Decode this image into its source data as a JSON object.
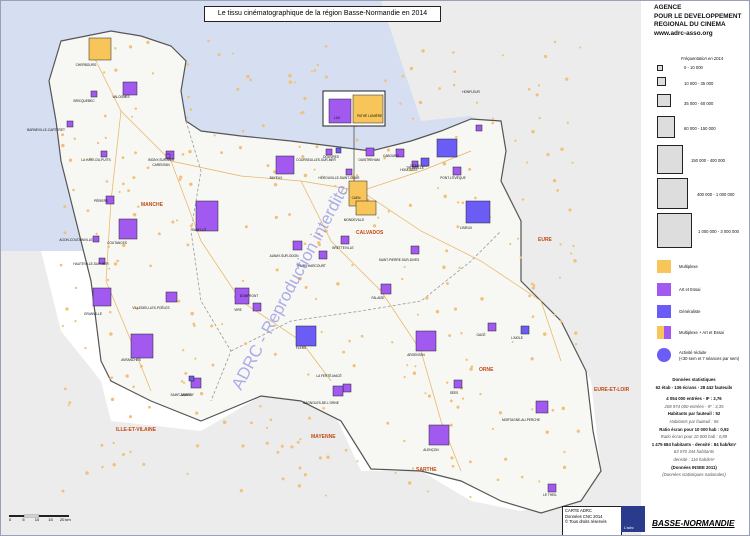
{
  "title": "Le tissu cinématographique de la région Basse-Normandie en 2014",
  "agency": {
    "line1": "AGENCE",
    "line2": "POUR LE DEVELOPPEMENT",
    "line3": "REGIONAL DU CINEMA",
    "url": "www.adrc-asso.org"
  },
  "legend": {
    "freq_title": "Fréquentation en 2014",
    "sizes": [
      "0 - 10 000",
      "10 000 - 35 000",
      "35 000 - 60 000",
      "60 000 - 150 000",
      "150 000 - 400 000",
      "400 000 - 1 000 000",
      "1 000 000 - 3 000 000"
    ],
    "categories": [
      {
        "label": "Multiplexe",
        "color": "#f8c55a"
      },
      {
        "label": "Art et Essai",
        "color": "#a259f0"
      },
      {
        "label": "Généraliste",
        "color": "#6a5cf4"
      },
      {
        "label": "Multiplexe + Art et Essai",
        "color": "#f8c55a"
      },
      {
        "label": "Activité réduite",
        "sub": "(<30 sem et 7 séances par sem)",
        "color": "#6a5cf4"
      }
    ]
  },
  "stats": {
    "heading": "Données statistiques",
    "l1": "62 étab - 136 écrans - 28 442 fauteuils",
    "l2": "4 054 000 entrées - IF : 2,76",
    "l2i": "208 974 000 entrées - IF : 3,35",
    "l3": "Habitants par fauteuil : 52",
    "l3i": "Habitants par fauteuil : 56",
    "l4": "Ratio écran pour 10 000 hab : 0,92",
    "l4i": "Ratio écran pour 10 000 hab : 0,89",
    "l5": "1 475 684 habitants - densité : 84 hab/km²",
    "l5i": "63 070 344 habitants",
    "l5i2": "densité : 116 hab/km²",
    "l6": "(Données INSEE 2011)",
    "l6i": "(Données statistiques nationales)"
  },
  "carte": {
    "l1": "CARTE ADRC",
    "l2": "Données CNC 2014",
    "l3": "Tous droits réservés"
  },
  "logo_text": "L'adrc",
  "region": "BASSE-NORMANDIE",
  "scale_labels": [
    "0",
    "5",
    "10",
    "15",
    "20 km"
  ],
  "watermark": "ADRC - Reproduction interdite",
  "departments": [
    "MANCHE",
    "CALVADOS",
    "ORNE",
    "EURE",
    "EURE-ET-LOIR",
    "ILLE-ET-VILAINE",
    "MAYENNE",
    "SARTHE"
  ],
  "cities": {
    "cherbourg": "CHERBOURG",
    "valognes": "VALOGNES",
    "briquebec": "BRICQUEBEC",
    "barneville": "BARNEVILLE-CARTERET",
    "isigny": "ISIGNY-SUR-MER",
    "carentan": "CARENTAN",
    "haye": "LA HAYE-DU-PUITS",
    "periers": "PÉRIERS",
    "coutances": "COUTANCES",
    "agon": "AGON-COUTAINVILLE",
    "hauteville": "HAUTEVILLE-SUR-MER",
    "granville": "GRANVILLE",
    "saintlo": "SAINT-LÔ",
    "villedieu": "VILLEDIEU-LES-POÊLES",
    "avranches": "AVRANCHES",
    "saintjames": "SAINT-JAMES",
    "vire": "VIRE",
    "bayeux": "BAYEUX",
    "caen": "CAEN",
    "mondeville": "MONDEVILLE",
    "herouville": "HÉROUVILLE-SAINT-CLAIR",
    "courseulles": "COURSEULLES-SUR-MER",
    "ouistreham": "OUISTREHAM",
    "cabourg": "CABOURG",
    "houlgate": "HOULGATE",
    "deauville": "DEAUVILLE",
    "trouville": "TROUVILLE",
    "honfleur": "HONFLEUR",
    "pontleveque": "PONT-L'ÉVÊQUE",
    "lisieux": "LISIEUX",
    "gace": "GACÉ",
    "laigle": "L'AIGLE",
    "falaise": "FALAISE",
    "stpierre": "SAINT-PIERRE-SUR-DIVES",
    "thury": "THURY-HARCOURT",
    "aunay": "AUNAY-SUR-ODON",
    "flers": "FLERS",
    "argentan": "ARGENTAN",
    "sees": "SÉES",
    "ferte": "LA FERTÉ-MACÉ",
    "bagnoles": "BAGNOLES-DE-L'ORNE",
    "domfront": "DOMFRONT",
    "alencon": "ALENÇON",
    "mortagne": "MORTAGNE-AU-PERCHE",
    "theil": "LE THEIL",
    "lux": "LUX",
    "pathe": "PATHÉ LUMIÈRE",
    "douvres": "DOUVRES",
    "bretteville": "BRETTEVILLE",
    "juvigny": "JUVIGNY"
  }
}
